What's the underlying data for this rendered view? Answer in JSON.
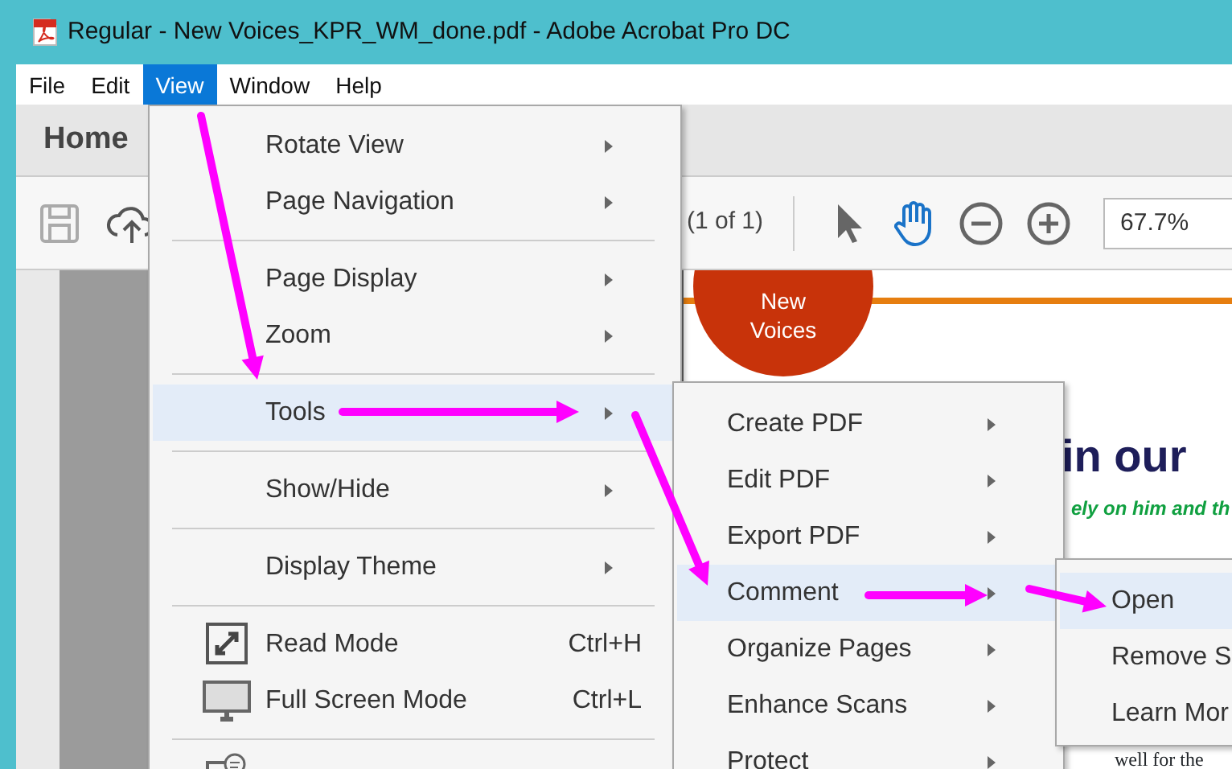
{
  "window": {
    "title": "Regular - New Voices_KPR_WM_done.pdf - Adobe Acrobat Pro DC"
  },
  "menu_bar": [
    {
      "label": "File",
      "selected": false
    },
    {
      "label": "Edit",
      "selected": false
    },
    {
      "label": "View",
      "selected": true
    },
    {
      "label": "Window",
      "selected": false
    },
    {
      "label": "Help",
      "selected": false
    }
  ],
  "home_tab": {
    "label": "Home"
  },
  "toolbar": {
    "file_tools": [
      {
        "kind": "save"
      },
      {
        "kind": "upload"
      }
    ],
    "page_count": "(1 of 1)",
    "tools": [
      {
        "kind": "pointer",
        "selected": false
      },
      {
        "kind": "hand",
        "selected": true
      },
      {
        "kind": "zoomout",
        "selected": false
      },
      {
        "kind": "zoomin",
        "selected": false
      }
    ],
    "zoom_value": "67.7%"
  },
  "document": {
    "badge_lines": [
      "New",
      "Voices"
    ],
    "heading": "in our",
    "subtitle": "ely on him and th",
    "body": "well for the"
  },
  "view_menu": [
    {
      "kind": "submenu",
      "label": "Rotate View",
      "selected": false
    },
    {
      "kind": "submenu",
      "label": "Page Navigation",
      "selected": false
    },
    {
      "kind": "separator"
    },
    {
      "kind": "submenu",
      "label": "Page Display",
      "selected": false
    },
    {
      "kind": "submenu",
      "label": "Zoom",
      "selected": false
    },
    {
      "kind": "separator"
    },
    {
      "kind": "submenu",
      "label": "Tools",
      "selected": true
    },
    {
      "kind": "separator"
    },
    {
      "kind": "submenu",
      "label": "Show/Hide",
      "selected": false
    },
    {
      "kind": "separator"
    },
    {
      "kind": "submenu",
      "label": "Display Theme",
      "selected": false
    },
    {
      "kind": "separator"
    },
    {
      "kind": "readmode",
      "label": "Read Mode",
      "shortcut": "Ctrl+H",
      "selected": false
    },
    {
      "kind": "fullscreen",
      "label": "Full Screen Mode",
      "shortcut": "Ctrl+L",
      "selected": false
    },
    {
      "kind": "separator"
    },
    {
      "kind": "partial"
    }
  ],
  "tools_menu": [
    {
      "label": "Create PDF",
      "selected": false
    },
    {
      "label": "Edit PDF",
      "selected": false
    },
    {
      "label": "Export PDF",
      "selected": false
    },
    {
      "label": "Comment",
      "selected": true
    },
    {
      "label": "Organize Pages",
      "selected": false
    },
    {
      "label": "Enhance Scans",
      "selected": false
    },
    {
      "label": "Protect",
      "selected": false
    }
  ],
  "comment_menu": [
    {
      "label": "Open",
      "selected": true
    },
    {
      "label": "Remove S",
      "selected": false
    },
    {
      "label": "Learn Mor",
      "selected": false
    }
  ]
}
